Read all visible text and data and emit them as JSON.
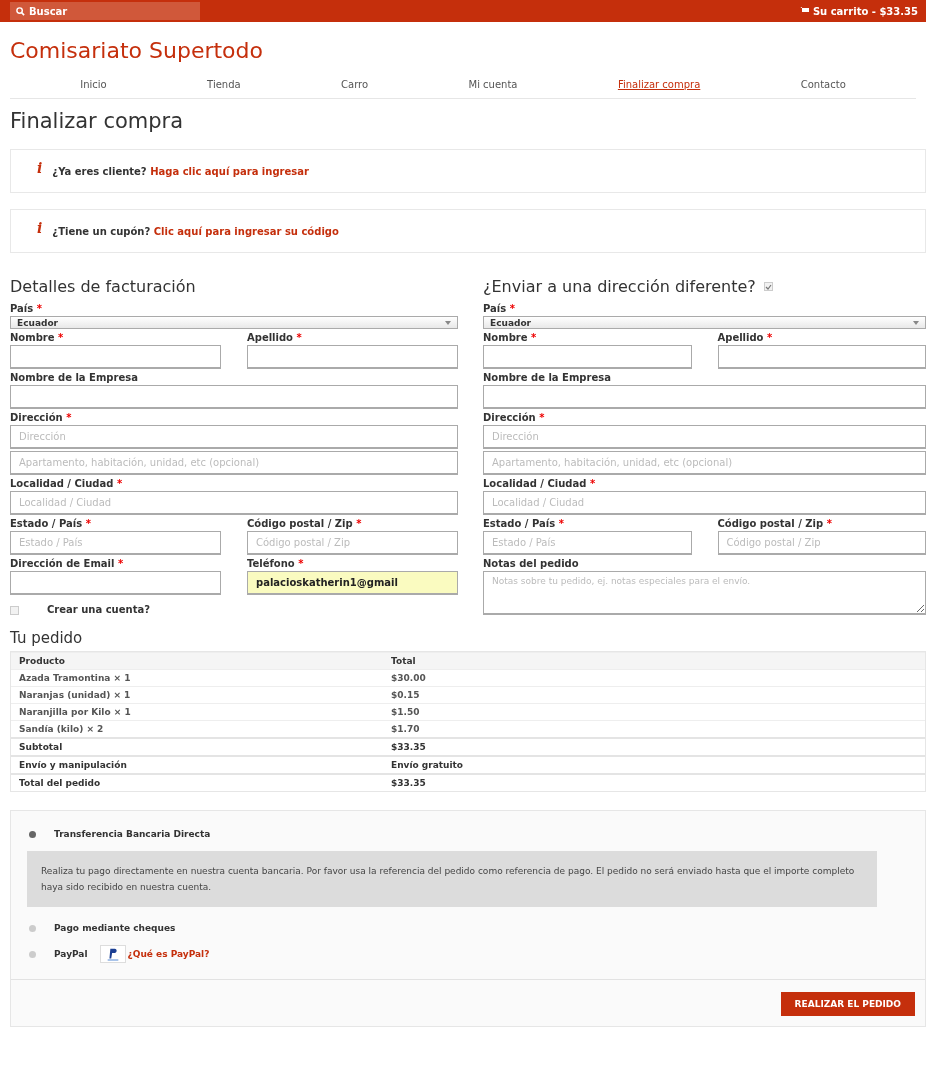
{
  "top_bar": {
    "search": "Buscar",
    "cart": "Su carrito - $33.35"
  },
  "site_title": "Comisariato Supertodo",
  "nav": [
    {
      "label": "Inicio",
      "selected": false
    },
    {
      "label": "Tienda",
      "selected": false
    },
    {
      "label": "Carro",
      "selected": false
    },
    {
      "label": "Mi cuenta",
      "selected": false
    },
    {
      "label": "Finalizar compra",
      "selected": true
    },
    {
      "label": "Contacto",
      "selected": false
    }
  ],
  "page_title": "Finalizar compra",
  "notices": [
    {
      "icon": "i",
      "text": "¿Ya eres cliente?",
      "link": "Haga clic aquí para ingresar"
    },
    {
      "icon": "i",
      "text": "¿Tiene un cupón?",
      "link": "Clic aquí para ingresar su código"
    }
  ],
  "billing": {
    "title": "Detalles de facturación",
    "rows": [
      {
        "fields": [
          {
            "label": "País",
            "mark": "*",
            "kind": "select",
            "value": "Ecuador"
          }
        ]
      },
      {
        "fields": [
          {
            "label": "Nombre",
            "mark": "*",
            "kind": "input"
          },
          {
            "label": "Apellido",
            "mark": "*",
            "kind": "input"
          }
        ]
      },
      {
        "fields": [
          {
            "label": "Nombre de la Empresa",
            "kind": "input"
          }
        ]
      },
      {
        "fields": [
          {
            "label": "Dirección",
            "mark": "*",
            "kind": "input",
            "placeholder": "Dirección"
          }
        ]
      },
      {
        "fields": [
          {
            "kind": "input",
            "placeholder": "Apartamento, habitación, unidad, etc (opcional)"
          }
        ]
      },
      {
        "fields": [
          {
            "label": "Localidad / Ciudad",
            "mark": "*",
            "kind": "input",
            "placeholder": "Localidad / Ciudad"
          }
        ]
      },
      {
        "fields": [
          {
            "label": "Estado / País",
            "mark": "*",
            "kind": "input",
            "placeholder": "Estado / País"
          },
          {
            "label": "Código postal / Zip",
            "mark": "*",
            "kind": "input",
            "placeholder": "Código postal / Zip"
          }
        ]
      },
      {
        "fields": [
          {
            "label": "Dirección de Email",
            "mark": "*",
            "kind": "input"
          },
          {
            "label": "Teléfono",
            "mark": "*",
            "kind": "input",
            "value": "palacioskatherin1@gmail",
            "autofilled": true
          }
        ]
      },
      {
        "fields": [
          {
            "label": "Crear una cuenta?",
            "kind": "checkbox",
            "checked": false
          }
        ]
      }
    ]
  },
  "shipping": {
    "title": "¿Enviar a una dirección diferente?",
    "checked": true,
    "rows": [
      {
        "fields": [
          {
            "label": "País",
            "mark": "*",
            "kind": "select",
            "value": "Ecuador"
          }
        ]
      },
      {
        "fields": [
          {
            "label": "Nombre",
            "mark": "*",
            "kind": "input"
          },
          {
            "label": "Apellido",
            "mark": "*",
            "kind": "input"
          }
        ]
      },
      {
        "fields": [
          {
            "label": "Nombre de la Empresa",
            "kind": "input"
          }
        ]
      },
      {
        "fields": [
          {
            "label": "Dirección",
            "mark": "*",
            "kind": "input",
            "placeholder": "Dirección"
          }
        ]
      },
      {
        "fields": [
          {
            "kind": "input",
            "placeholder": "Apartamento, habitación, unidad, etc (opcional)"
          }
        ]
      },
      {
        "fields": [
          {
            "label": "Localidad / Ciudad",
            "mark": "*",
            "kind": "input",
            "placeholder": "Localidad / Ciudad"
          }
        ]
      },
      {
        "fields": [
          {
            "label": "Estado / País",
            "mark": "*",
            "kind": "input",
            "placeholder": "Estado / País"
          },
          {
            "label": "Código postal / Zip",
            "mark": "*",
            "kind": "input",
            "placeholder": "Código postal / Zip"
          }
        ]
      },
      {
        "fields": [
          {
            "label": "Notas del pedido",
            "kind": "textarea",
            "placeholder": "Notas sobre tu pedido, ej. notas especiales para el envío."
          }
        ]
      }
    ]
  },
  "order": {
    "title": "Tu pedido",
    "columns": [
      "Producto",
      "Total"
    ],
    "rows": [
      {
        "kind": "item",
        "product": "Azada Tramontina × 1",
        "total": "$30.00"
      },
      {
        "kind": "item",
        "product": "Naranjas (unidad) × 1",
        "total": "$0.15"
      },
      {
        "kind": "item",
        "product": "Naranjilla por Kilo × 1",
        "total": "$1.50"
      },
      {
        "kind": "item",
        "product": "Sandía (kilo) × 2",
        "total": "$1.70"
      },
      {
        "kind": "summary",
        "product": "Subtotal",
        "total": "$33.35"
      },
      {
        "kind": "summary",
        "product": "Envío y manipulación",
        "total": "Envío gratuito"
      },
      {
        "kind": "summary",
        "product": "Total del pedido",
        "total": "$33.35"
      }
    ]
  },
  "payment": {
    "methods": [
      {
        "label": "Transferencia Bancaria Directa",
        "selected": true,
        "description": "Realiza tu pago directamente en nuestra cuenta bancaria. Por favor usa la referencia del pedido como referencia de pago. El pedido no será enviado hasta que el importe completo haya sido recibido en nuestra cuenta."
      },
      {
        "label": "Pago mediante cheques",
        "selected": false
      },
      {
        "label": "PayPal",
        "selected": false,
        "logo": true,
        "link": "¿Qué es PayPal?"
      }
    ],
    "button": "REALIZAR EL PEDIDO"
  }
}
